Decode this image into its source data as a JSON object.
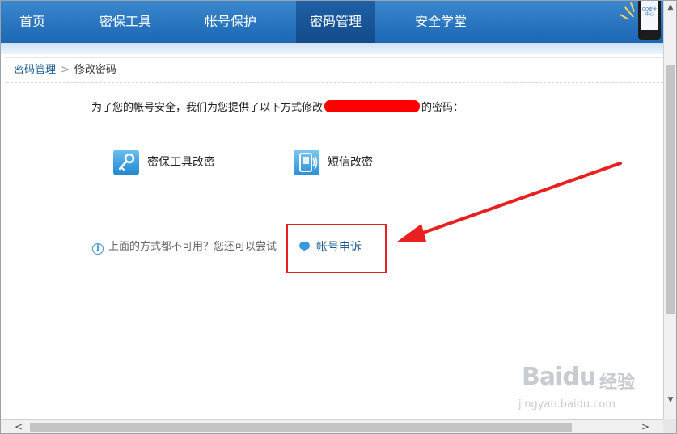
{
  "nav": {
    "items": [
      {
        "label": "首页",
        "active": false
      },
      {
        "label": "密保工具",
        "active": false
      },
      {
        "label": "帐号保护",
        "active": false
      },
      {
        "label": "密码管理",
        "active": true
      },
      {
        "label": "安全学堂",
        "active": false
      }
    ],
    "badge_text": "QQ安全中心"
  },
  "breadcrumb": {
    "parent": "密码管理",
    "separator": ">",
    "current": "修改密码"
  },
  "intro": {
    "prefix": "为了您的帐号安全，我们为您提供了以下方式修改",
    "suffix": "的密码："
  },
  "options": [
    {
      "label": "密保工具改密",
      "icon": "key-icon"
    },
    {
      "label": "短信改密",
      "icon": "phone-sms-icon"
    }
  ],
  "hint": {
    "text": "上面的方式都不可用？您还可以尝试",
    "link_label": "帐号申诉"
  },
  "watermark": {
    "main": "Baidu",
    "cn": "经验",
    "sub": "jingyan.baidu.com"
  },
  "colors": {
    "nav_bg": "#1c66b3",
    "link": "#1a5b93",
    "annotation_red": "#e8201f"
  }
}
